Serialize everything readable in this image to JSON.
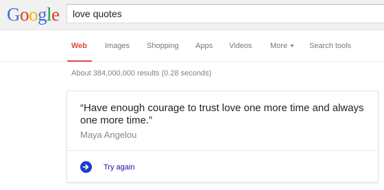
{
  "logo": {
    "l1": "G",
    "l2": "o",
    "l3": "o",
    "l4": "g",
    "l5": "l",
    "l6": "e"
  },
  "search": {
    "query": "love quotes"
  },
  "tabs": [
    "Web",
    "Images",
    "Shopping",
    "Apps",
    "Videos",
    "More",
    "Search tools"
  ],
  "active_tab": "Web",
  "results": {
    "stats": "About 384,000,000 results (0.28 seconds)"
  },
  "card": {
    "quote": "“Have enough courage to trust love one more time and always one more time.”",
    "author": "Maya Angelou",
    "action_label": "Try again"
  },
  "colors": {
    "accent": "#dd4b39",
    "link": "#1a0dab",
    "action_icon": "#1a3cce"
  },
  "icons": {
    "more_dropdown": "caret-down-icon",
    "try_again": "arrow-right-circle-icon"
  }
}
